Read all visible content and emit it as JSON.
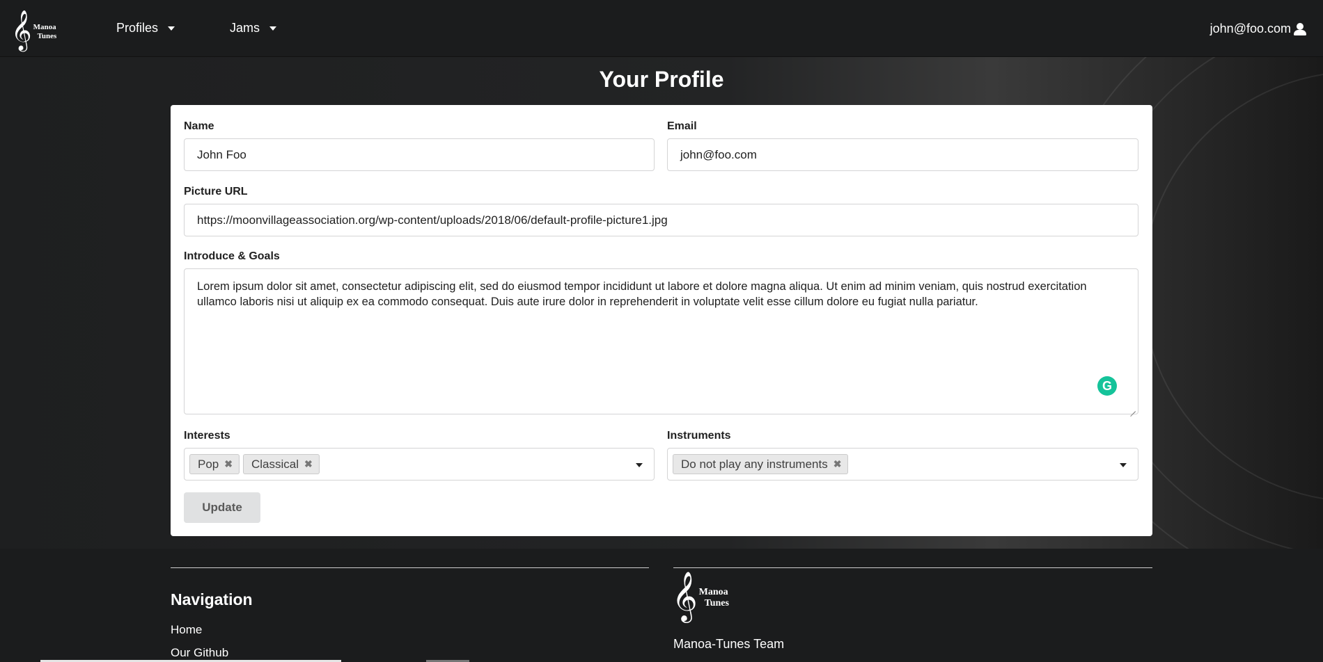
{
  "app": {
    "logo": {
      "line1": "Manoa",
      "line2": "Tunes",
      "glyph": "𝄞"
    }
  },
  "nav": {
    "items": [
      {
        "label": "Profiles"
      },
      {
        "label": "Jams"
      }
    ],
    "user_email": "john@foo.com"
  },
  "page": {
    "title": "Your Profile"
  },
  "form": {
    "name": {
      "label": "Name",
      "value": "John Foo"
    },
    "email": {
      "label": "Email",
      "value": "john@foo.com"
    },
    "picture": {
      "label": "Picture URL",
      "value": "https://moonvillageassociation.org/wp-content/uploads/2018/06/default-profile-picture1.jpg"
    },
    "intro": {
      "label": "Introduce & Goals",
      "value": "Lorem ipsum dolor sit amet, consectetur adipiscing elit, sed do eiusmod tempor incididunt ut labore et dolore magna aliqua. Ut enim ad minim veniam, quis nostrud exercitation ullamco laboris nisi ut aliquip ex ea commodo consequat. Duis aute irure dolor in reprehenderit in voluptate velit esse cillum dolore eu fugiat nulla pariatur."
    },
    "interests": {
      "label": "Interests",
      "chips": [
        "Pop",
        "Classical"
      ]
    },
    "instruments": {
      "label": "Instruments",
      "chips": [
        "Do not play any instruments"
      ]
    },
    "submit_label": "Update"
  },
  "footer": {
    "nav_heading": "Navigation",
    "links": [
      "Home",
      "Our Github"
    ],
    "logo": {
      "line1": "Manoa",
      "line2": "Tunes",
      "glyph": "𝄞"
    },
    "team": "Manoa-Tunes Team"
  },
  "colors": {
    "background": "#1b1c1d",
    "card": "#ffffff",
    "chip": "#e8e8e8",
    "button": "#e0e1e2",
    "grammarly": "#15c39a"
  },
  "icons": [
    "treble-clef-logo-icon",
    "caret-down-icon",
    "user-icon",
    "remove-chip-icon",
    "grammarly-icon"
  ]
}
